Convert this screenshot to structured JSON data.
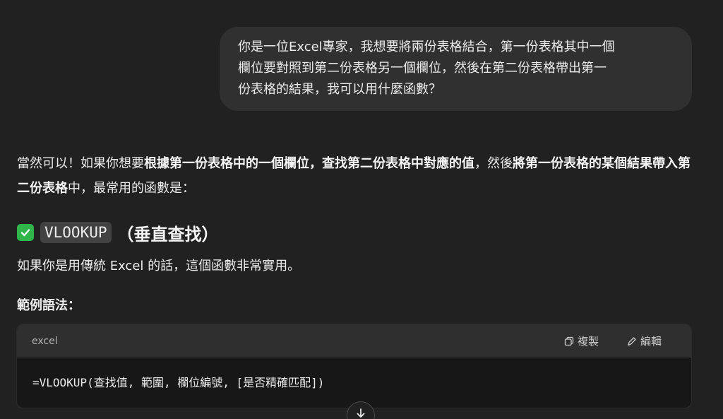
{
  "user_message": {
    "lines": [
      "你是一位Excel專家，我想要將兩份表格結合，第一份表格其中一個",
      "欄位要對照到第二份表格另一個欄位，然後在第二份表格帶出第一",
      "份表格的結果，我可以用什麼函數？"
    ]
  },
  "response": {
    "para1": {
      "t1": "當然可以！如果你想要",
      "b1": "根據第一份表格中的一個欄位，查找第二份表格中對應的值",
      "t2": "，然後",
      "b2": "將第一份表格的某個結果帶入第二份表格",
      "t3": "中，最常用的函數是："
    },
    "heading": {
      "check_glyph": "✓",
      "code": "VLOOKUP",
      "text": "（垂直查找）"
    },
    "intro": "如果你是用傳統 Excel 的話，這個函數非常實用。",
    "syntax_label": "範例語法：",
    "code_block": {
      "language": "excel",
      "copy_label": "複製",
      "edit_label": "編輯",
      "code": "=VLOOKUP(查找值, 範圍, 欄位編號, [是否精確匹配])"
    }
  },
  "icons": {
    "check": "check-box-icon",
    "copy": "copy-icon",
    "edit": "pencil-icon",
    "scroll": "arrow-down-icon"
  },
  "colors": {
    "background": "#212121",
    "user_bubble": "#303030",
    "check_green": "#2fb54a",
    "code_header": "#2f2f2f",
    "code_body": "#171717"
  }
}
